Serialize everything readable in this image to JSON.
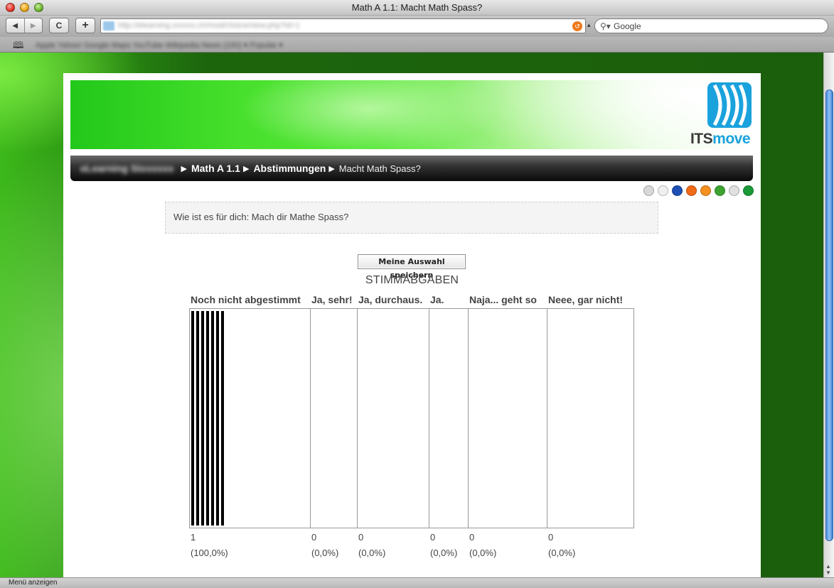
{
  "window": {
    "title": "Math A 1.1: Macht Math Spass?"
  },
  "toolbar": {
    "back_glyph": "◀",
    "forward_glyph": "▶",
    "reload_glyph": "C",
    "add_glyph": "+",
    "address_text": "http://elearning.xxxxxx.ch/mod/choice/view.php?id=1",
    "search_text": "Google"
  },
  "bookmarks": {
    "text": "Apple  Yahoo!  Google Maps  YouTube  Wikipedia  News (150) ▾  Popular ▾"
  },
  "nav": {
    "root": "eLearning Stxxxxxx",
    "course": "Math A 1.1",
    "section": "Abstimmungen",
    "current": "Macht Math Spass?"
  },
  "logo": {
    "its": "ITS",
    "move": "move"
  },
  "question": {
    "text": "Wie ist es für dich: Mach dir Mathe Spass?"
  },
  "save_button": {
    "label": "Meine Auswahl speichern"
  },
  "results": {
    "heading": "STIMMABGABEN"
  },
  "chart_data": {
    "type": "bar",
    "categories": [
      "Noch nicht abgestimmt",
      "Ja, sehr!",
      "Ja, durchaus.",
      "Ja.",
      "Naja... geht so",
      "Neee, gar nicht!"
    ],
    "values": [
      1,
      0,
      0,
      0,
      0,
      0
    ],
    "percent_labels": [
      "(100,0%)",
      "(0,0%)",
      "(0,0%)",
      "(0,0%)",
      "(0,0%)",
      "(0,0%)"
    ],
    "title": "STIMMABGABEN",
    "ylim": [
      0,
      1
    ]
  },
  "share_icons": [
    {
      "name": "delicious-icon",
      "color": "#d8d8d8"
    },
    {
      "name": "digg-icon",
      "color": "#f0f0f0"
    },
    {
      "name": "mixx-icon",
      "color": "#1d4fb5"
    },
    {
      "name": "furl-icon",
      "color": "#f06a17"
    },
    {
      "name": "stumbleupon-icon",
      "color": "#f6901e"
    },
    {
      "name": "technorati-icon",
      "color": "#3ca330"
    },
    {
      "name": "reddit-icon",
      "color": "#e0e0e0"
    },
    {
      "name": "newsvine-icon",
      "color": "#1a9a39"
    }
  ],
  "status": {
    "text": "Menü anzeigen"
  }
}
